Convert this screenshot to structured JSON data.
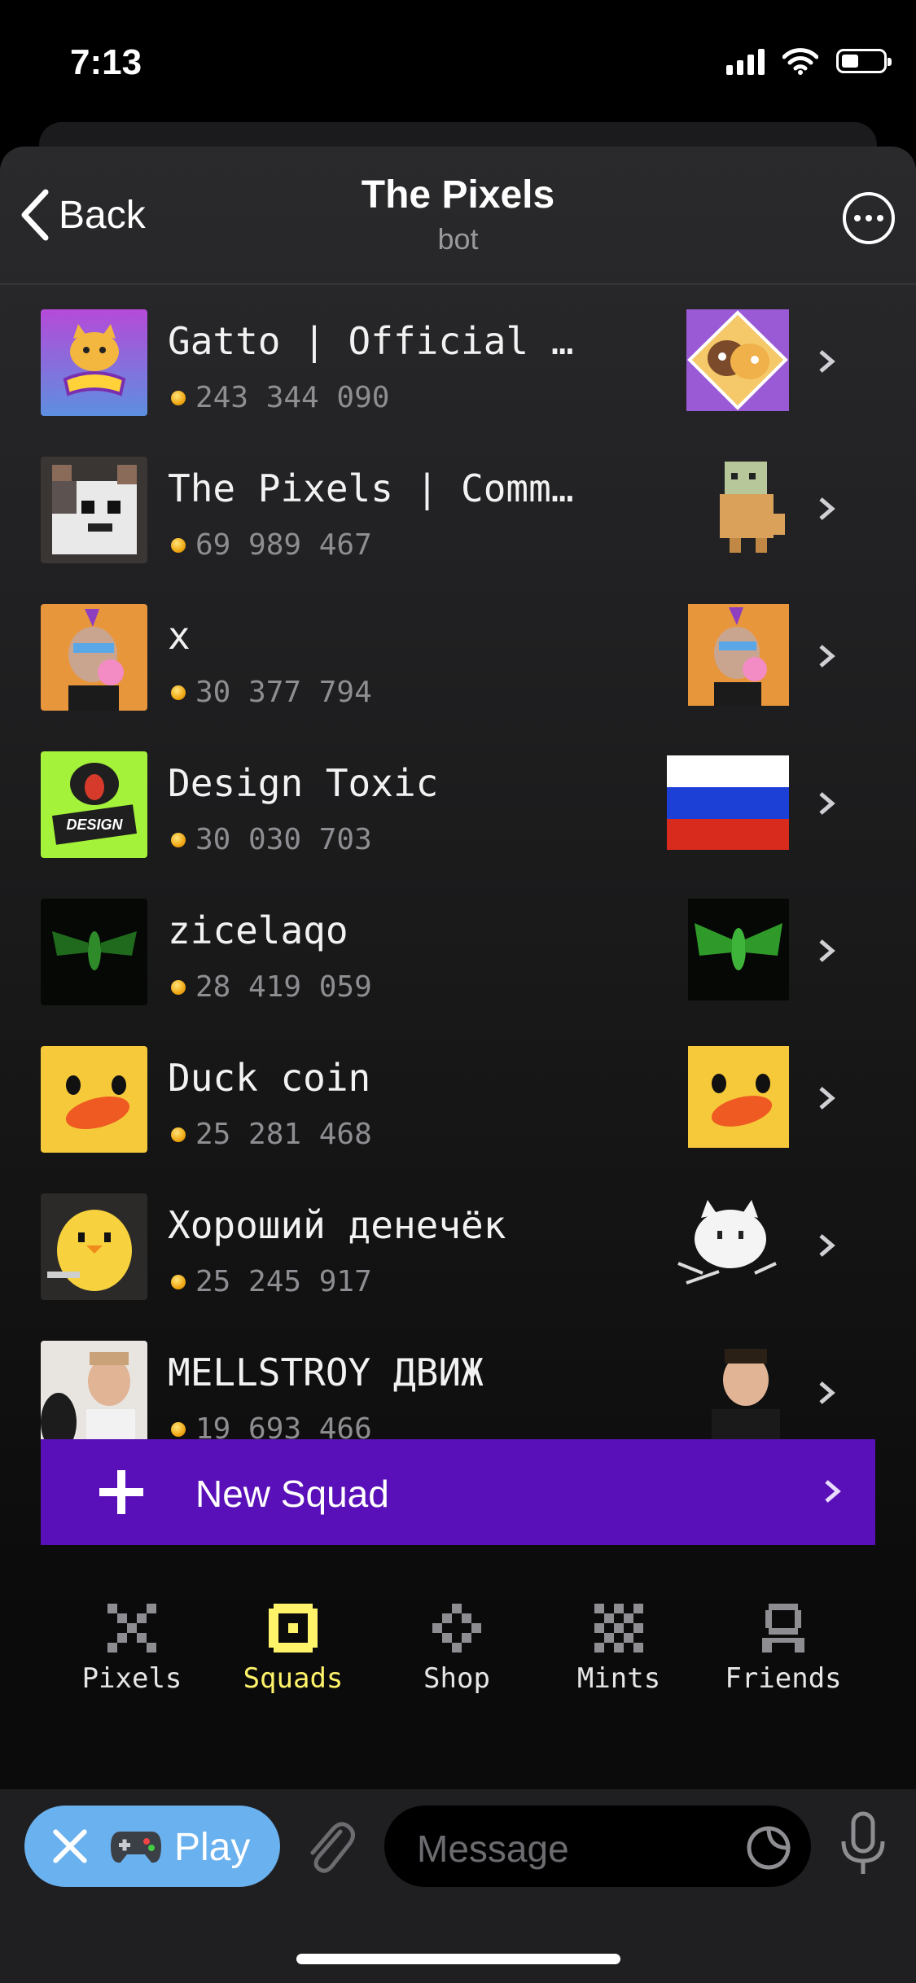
{
  "status_bar": {
    "time": "7:13"
  },
  "header": {
    "back_label": "Back",
    "title": "The Pixels",
    "subtitle": "bot"
  },
  "squads": [
    {
      "name": "Gatto | Official C…",
      "score": "243 344 090",
      "avatar": "gatto-avatar",
      "thumb": "gatto-sticker"
    },
    {
      "name": "The Pixels | Commu…",
      "score": "69 989 467",
      "avatar": "pixel-cat-avatar",
      "thumb": "pixel-dog-sticker"
    },
    {
      "name": "x",
      "score": "30 377 794",
      "avatar": "ape-avatar",
      "thumb": "ape-sticker"
    },
    {
      "name": "Design Toxic",
      "score": "30 030 703",
      "avatar": "cobra-avatar",
      "thumb": "russia-flag"
    },
    {
      "name": "zicelaqo",
      "score": "28 419 059",
      "avatar": "cicada-avatar",
      "thumb": "cicada-sticker"
    },
    {
      "name": "Duck coin",
      "score": "25 281 468",
      "avatar": "duck-avatar",
      "thumb": "duck-sticker"
    },
    {
      "name": "Хороший денечёк",
      "score": "25 245 917",
      "avatar": "chick-avatar",
      "thumb": "cat-sticker"
    },
    {
      "name": "MELLSTROY ДВИЖ",
      "score": "19 693 466",
      "avatar": "person-avatar",
      "thumb": "person-sticker"
    }
  ],
  "new_squad": {
    "label": "New Squad"
  },
  "tabs": [
    {
      "label": "Pixels",
      "icon": "x-pixel-icon",
      "active": false
    },
    {
      "label": "Squads",
      "icon": "squads-pixel-icon",
      "active": true
    },
    {
      "label": "Shop",
      "icon": "shop-pixel-icon",
      "active": false
    },
    {
      "label": "Mints",
      "icon": "mints-pixel-icon",
      "active": false
    },
    {
      "label": "Friends",
      "icon": "friends-pixel-icon",
      "active": false
    }
  ],
  "bottom_bar": {
    "play_label": "Play",
    "message_placeholder": "Message"
  },
  "colors": {
    "accent_purple": "#5a10b8",
    "active_tab": "#fff36a",
    "play_button": "#6ab1ef",
    "coin": "#f0a814"
  }
}
